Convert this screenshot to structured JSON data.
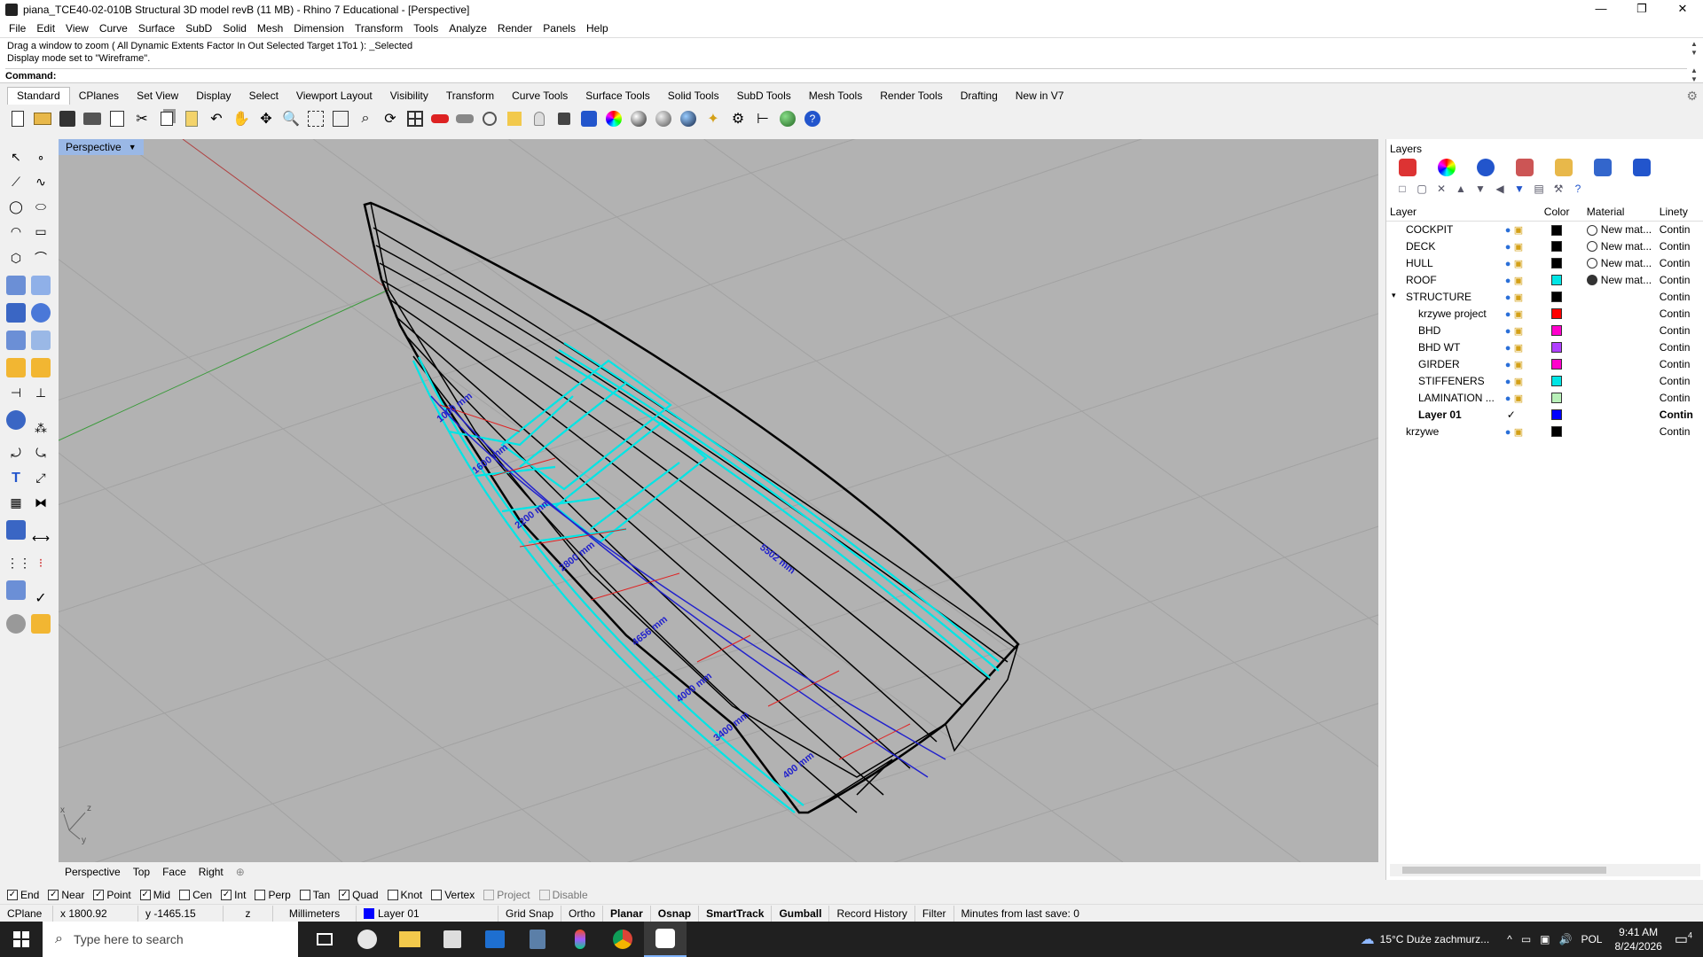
{
  "window": {
    "title": "piana_TCE40-02-010B Structural 3D model revB (11 MB) - Rhino 7 Educational - [Perspective]",
    "controls": [
      "—",
      "❐",
      "✕"
    ]
  },
  "menu": [
    "File",
    "Edit",
    "View",
    "Curve",
    "Surface",
    "SubD",
    "Solid",
    "Mesh",
    "Dimension",
    "Transform",
    "Tools",
    "Analyze",
    "Render",
    "Panels",
    "Help"
  ],
  "command": {
    "history": [
      "Drag a window to zoom ( All  Dynamic  Extents  Factor  In  Out  Selected  Target  1To1 ): _Selected",
      "Display mode set to \"Wireframe\"."
    ],
    "prompt": "Command:",
    "value": ""
  },
  "toolbar_tabs": [
    "Standard",
    "CPlanes",
    "Set View",
    "Display",
    "Select",
    "Viewport Layout",
    "Visibility",
    "Transform",
    "Curve Tools",
    "Surface Tools",
    "Solid Tools",
    "SubD Tools",
    "Mesh Tools",
    "Render Tools",
    "Drafting",
    "New in V7"
  ],
  "active_tab": "Standard",
  "viewport": {
    "name": "Perspective",
    "dimensions": [
      "5502 mm",
      "4656 mm",
      "4000 mm",
      "3400 mm",
      "2800 mm",
      "2200 mm",
      "1600 mm",
      "1000 mm",
      "400 mm"
    ],
    "axis_labels": [
      "x",
      "y",
      "z"
    ]
  },
  "viewport_tabs": [
    "Perspective",
    "Top",
    "Face",
    "Right",
    "⊕"
  ],
  "layers_panel": {
    "title": "Layers",
    "columns": [
      "Layer",
      "Color",
      "Material",
      "Linety"
    ],
    "rows": [
      {
        "name": "COCKPIT",
        "color": "#000000",
        "material": "New mat...",
        "linetype": "Contin"
      },
      {
        "name": "DECK",
        "color": "#000000",
        "material": "New mat...",
        "linetype": "Contin"
      },
      {
        "name": "HULL",
        "color": "#000000",
        "material": "New mat...",
        "linetype": "Contin"
      },
      {
        "name": "ROOF",
        "color": "#00e5e5",
        "material": "New mat...",
        "linetype": "Contin"
      },
      {
        "name": "STRUCTURE",
        "color": "#000000",
        "material": "",
        "linetype": "Contin"
      },
      {
        "name": "krzywe project",
        "color": "#ff0000",
        "material": "",
        "linetype": "Contin"
      },
      {
        "name": "BHD",
        "color": "#ff00cc",
        "material": "",
        "linetype": "Contin"
      },
      {
        "name": "BHD WT",
        "color": "#b040ff",
        "material": "",
        "linetype": "Contin"
      },
      {
        "name": "GIRDER",
        "color": "#ff00cc",
        "material": "",
        "linetype": "Contin"
      },
      {
        "name": "STIFFENERS",
        "color": "#00e5e5",
        "material": "",
        "linetype": "Contin"
      },
      {
        "name": "LAMINATION ...",
        "color": "#b8f0b8",
        "material": "",
        "linetype": "Contin"
      },
      {
        "name": "Layer 01",
        "color": "#0000ff",
        "material": "",
        "linetype": "Contin"
      },
      {
        "name": "krzywe",
        "color": "#000000",
        "material": "",
        "linetype": "Contin"
      }
    ]
  },
  "osnaps": [
    {
      "label": "End",
      "checked": true
    },
    {
      "label": "Near",
      "checked": true
    },
    {
      "label": "Point",
      "checked": true
    },
    {
      "label": "Mid",
      "checked": true
    },
    {
      "label": "Cen",
      "checked": false
    },
    {
      "label": "Int",
      "checked": true
    },
    {
      "label": "Perp",
      "checked": false
    },
    {
      "label": "Tan",
      "checked": false
    },
    {
      "label": "Quad",
      "checked": true
    },
    {
      "label": "Knot",
      "checked": false
    },
    {
      "label": "Vertex",
      "checked": false
    },
    {
      "label": "Project",
      "checked": false
    },
    {
      "label": "Disable",
      "checked": false
    }
  ],
  "statusbar": {
    "cplane": "CPlane",
    "x": "x 1800.92",
    "y": "y -1465.15",
    "z": "z",
    "units": "Millimeters",
    "layer": "Layer 01",
    "grid_snap": "Grid Snap",
    "ortho": "Ortho",
    "planar": "Planar",
    "osnap": "Osnap",
    "smarttrack": "SmartTrack",
    "gumball": "Gumball",
    "record_history": "Record History",
    "filter": "Filter",
    "save_info": "Minutes from last save: 0"
  },
  "taskbar": {
    "search_placeholder": "Type here to search",
    "weather": "15°C  Duże zachmurz...",
    "lang": "POL",
    "time": "9:41 AM",
    "date": "8/24/2026",
    "notif_count": "4"
  }
}
